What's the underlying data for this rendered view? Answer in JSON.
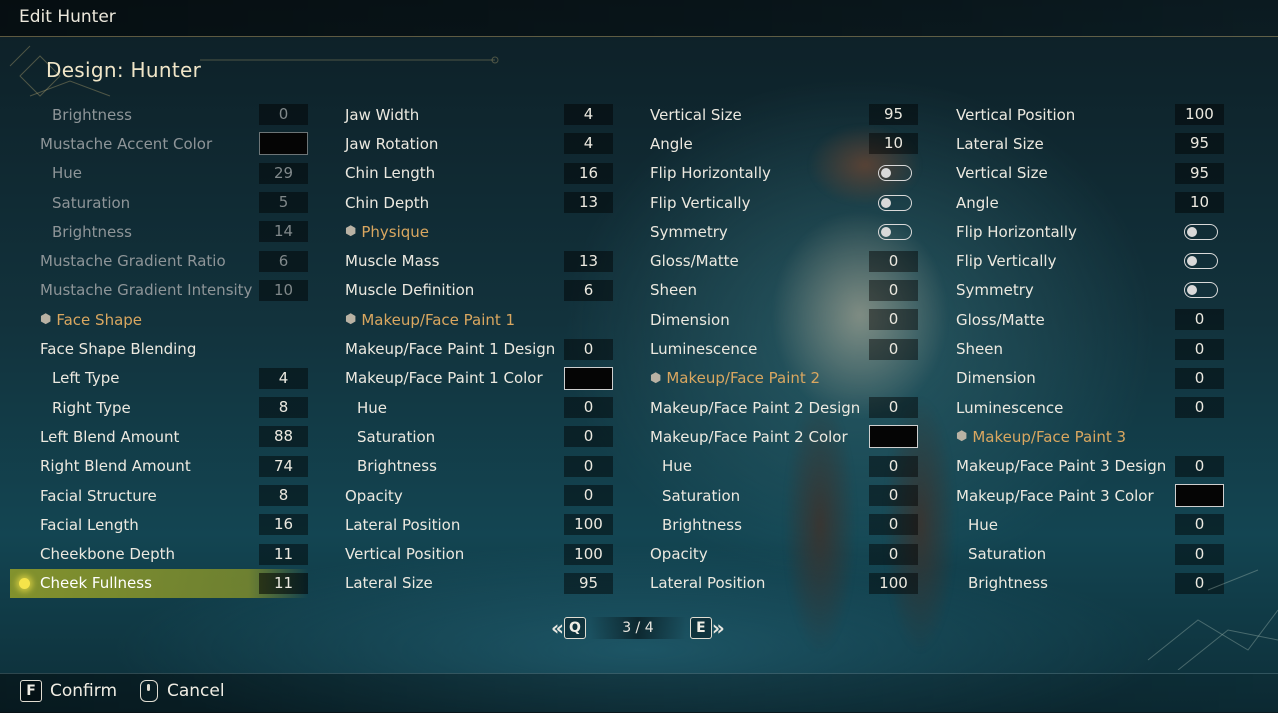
{
  "window_title": "Edit Hunter",
  "page_title": "Design: Hunter",
  "columns": [
    [
      {
        "label": "Brightness",
        "value": "0",
        "type": "value",
        "sub": true,
        "dim": true
      },
      {
        "label": "Mustache Accent Color",
        "type": "color",
        "dim": true
      },
      {
        "label": "Hue",
        "value": "29",
        "type": "value",
        "sub": true,
        "dim": true
      },
      {
        "label": "Saturation",
        "value": "5",
        "type": "value",
        "sub": true,
        "dim": true
      },
      {
        "label": "Brightness",
        "value": "14",
        "type": "value",
        "sub": true,
        "dim": true
      },
      {
        "label": "Mustache Gradient Ratio",
        "value": "6",
        "type": "value",
        "dim": true
      },
      {
        "label": "Mustache Gradient Intensity",
        "value": "10",
        "type": "value",
        "dim": true
      },
      {
        "label": "Face Shape",
        "type": "section"
      },
      {
        "label": "Face Shape Blending",
        "type": "header"
      },
      {
        "label": "Left Type",
        "value": "4",
        "type": "value",
        "sub": true
      },
      {
        "label": "Right Type",
        "value": "8",
        "type": "value",
        "sub": true
      },
      {
        "label": "Left Blend Amount",
        "value": "88",
        "type": "value"
      },
      {
        "label": "Right Blend Amount",
        "value": "74",
        "type": "value"
      },
      {
        "label": "Facial Structure",
        "value": "8",
        "type": "value"
      },
      {
        "label": "Facial Length",
        "value": "16",
        "type": "value"
      },
      {
        "label": "Cheekbone Depth",
        "value": "11",
        "type": "value"
      },
      {
        "label": "Cheek Fullness",
        "value": "11",
        "type": "value",
        "selected": true
      }
    ],
    [
      {
        "label": "Jaw Width",
        "value": "4",
        "type": "value"
      },
      {
        "label": "Jaw Rotation",
        "value": "4",
        "type": "value"
      },
      {
        "label": "Chin Length",
        "value": "16",
        "type": "value"
      },
      {
        "label": "Chin Depth",
        "value": "13",
        "type": "value"
      },
      {
        "label": "Physique",
        "type": "section"
      },
      {
        "label": "Muscle Mass",
        "value": "13",
        "type": "value"
      },
      {
        "label": "Muscle Definition",
        "value": "6",
        "type": "value"
      },
      {
        "label": "Makeup/Face Paint 1",
        "type": "section"
      },
      {
        "label": "Makeup/Face Paint 1 Design",
        "value": "0",
        "type": "value"
      },
      {
        "label": "Makeup/Face Paint 1 Color",
        "type": "color"
      },
      {
        "label": "Hue",
        "value": "0",
        "type": "value",
        "sub": true
      },
      {
        "label": "Saturation",
        "value": "0",
        "type": "value",
        "sub": true
      },
      {
        "label": "Brightness",
        "value": "0",
        "type": "value",
        "sub": true
      },
      {
        "label": "Opacity",
        "value": "0",
        "type": "value"
      },
      {
        "label": "Lateral Position",
        "value": "100",
        "type": "value"
      },
      {
        "label": "Vertical Position",
        "value": "100",
        "type": "value"
      },
      {
        "label": "Lateral Size",
        "value": "95",
        "type": "value"
      }
    ],
    [
      {
        "label": "Vertical Size",
        "value": "95",
        "type": "value"
      },
      {
        "label": "Angle",
        "value": "10",
        "type": "value"
      },
      {
        "label": "Flip Horizontally",
        "type": "toggle"
      },
      {
        "label": "Flip Vertically",
        "type": "toggle"
      },
      {
        "label": "Symmetry",
        "type": "toggle"
      },
      {
        "label": "Gloss/Matte",
        "value": "0",
        "type": "value"
      },
      {
        "label": "Sheen",
        "value": "0",
        "type": "value"
      },
      {
        "label": "Dimension",
        "value": "0",
        "type": "value"
      },
      {
        "label": "Luminescence",
        "value": "0",
        "type": "value"
      },
      {
        "label": "Makeup/Face Paint 2",
        "type": "section"
      },
      {
        "label": "Makeup/Face Paint 2 Design",
        "value": "0",
        "type": "value"
      },
      {
        "label": "Makeup/Face Paint 2 Color",
        "type": "color"
      },
      {
        "label": "Hue",
        "value": "0",
        "type": "value",
        "sub": true
      },
      {
        "label": "Saturation",
        "value": "0",
        "type": "value",
        "sub": true
      },
      {
        "label": "Brightness",
        "value": "0",
        "type": "value",
        "sub": true
      },
      {
        "label": "Opacity",
        "value": "0",
        "type": "value"
      },
      {
        "label": "Lateral Position",
        "value": "100",
        "type": "value"
      }
    ],
    [
      {
        "label": "Vertical Position",
        "value": "100",
        "type": "value"
      },
      {
        "label": "Lateral Size",
        "value": "95",
        "type": "value"
      },
      {
        "label": "Vertical Size",
        "value": "95",
        "type": "value"
      },
      {
        "label": "Angle",
        "value": "10",
        "type": "value"
      },
      {
        "label": "Flip Horizontally",
        "type": "toggle"
      },
      {
        "label": "Flip Vertically",
        "type": "toggle"
      },
      {
        "label": "Symmetry",
        "type": "toggle"
      },
      {
        "label": "Gloss/Matte",
        "value": "0",
        "type": "value"
      },
      {
        "label": "Sheen",
        "value": "0",
        "type": "value"
      },
      {
        "label": "Dimension",
        "value": "0",
        "type": "value"
      },
      {
        "label": "Luminescence",
        "value": "0",
        "type": "value"
      },
      {
        "label": "Makeup/Face Paint 3",
        "type": "section"
      },
      {
        "label": "Makeup/Face Paint 3 Design",
        "value": "0",
        "type": "value"
      },
      {
        "label": "Makeup/Face Paint 3 Color",
        "type": "color"
      },
      {
        "label": "Hue",
        "value": "0",
        "type": "value",
        "sub": true
      },
      {
        "label": "Saturation",
        "value": "0",
        "type": "value",
        "sub": true
      },
      {
        "label": "Brightness",
        "value": "0",
        "type": "value",
        "sub": true
      }
    ]
  ],
  "pager": {
    "prev_key": "Q",
    "next_key": "E",
    "page_indicator": "3 / 4"
  },
  "footer": {
    "confirm_key": "F",
    "confirm_label": "Confirm",
    "cancel_label": "Cancel"
  },
  "colors": {
    "accent": "#d9a760",
    "selected_bg": "#969f28",
    "selected_dot": "#f5e34a",
    "swatch_color": "#050505"
  },
  "icons": {
    "section": "hexagon-icon",
    "pager_prev": "double-chevron-left-icon",
    "pager_next": "double-chevron-right-icon",
    "cancel": "mouse-icon"
  }
}
